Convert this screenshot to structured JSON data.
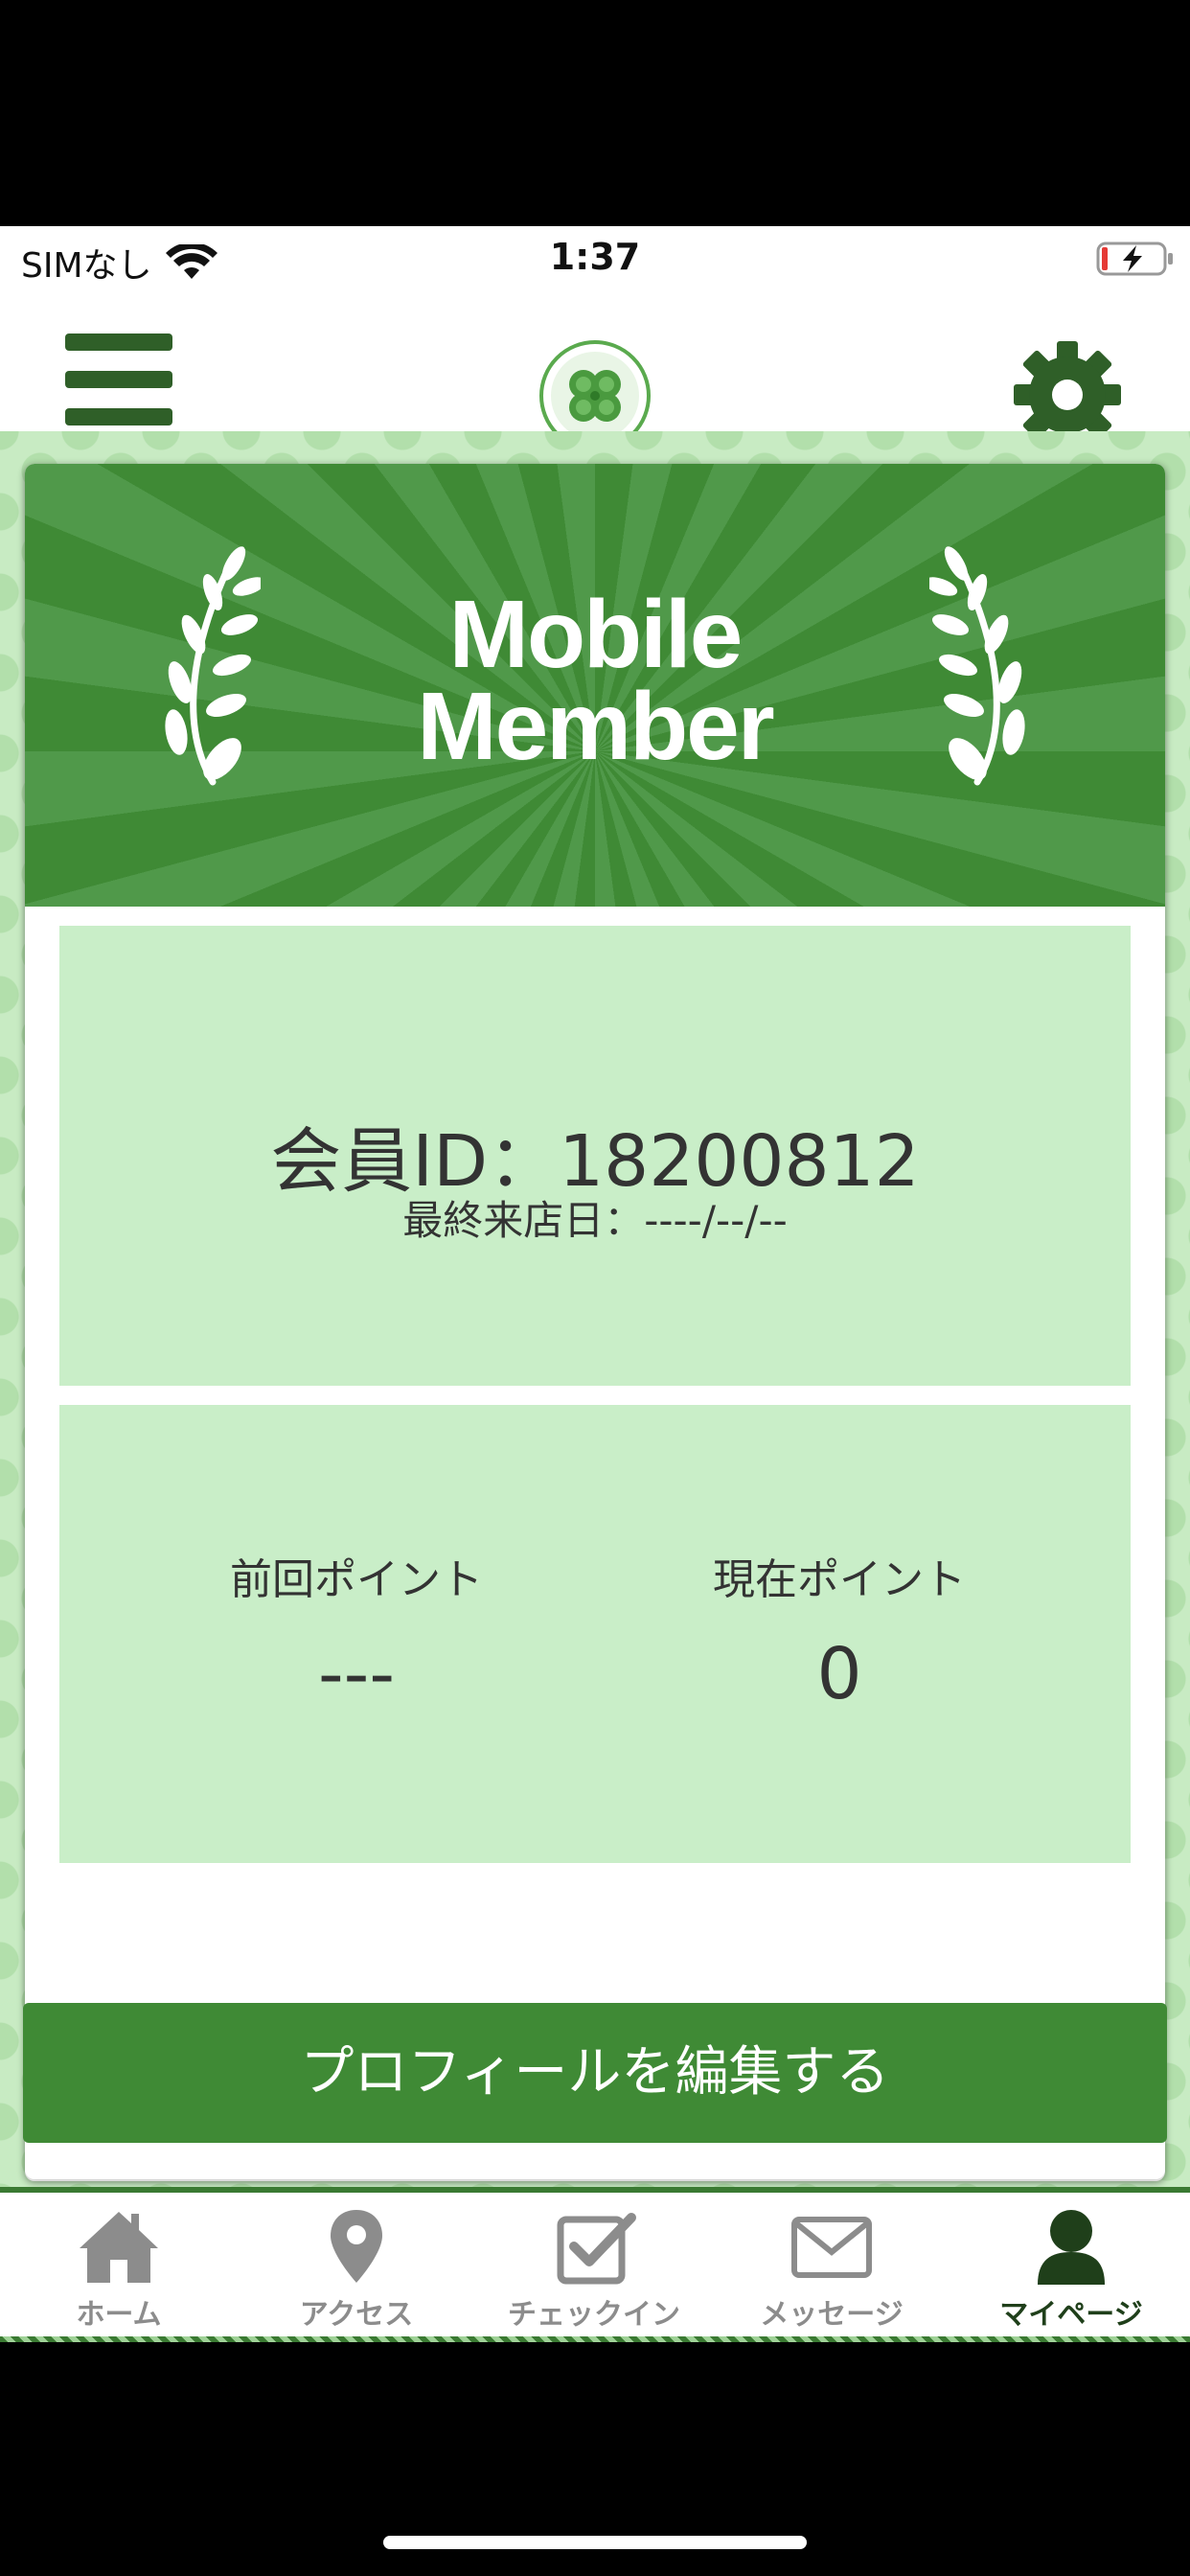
{
  "status_bar": {
    "carrier": "SIMなし",
    "time": "1:37"
  },
  "nav": {
    "menu_icon": "hamburger-menu-icon",
    "logo_icon": "clover-logo-icon",
    "settings_icon": "gear-icon"
  },
  "card": {
    "title_line1": "Mobile",
    "title_line2": "Member",
    "member_id": "会員ID：18200812",
    "last_visit": "最終来店日：----/--/--",
    "previous_points_label": "前回ポイント",
    "previous_points_value": "---",
    "current_points_label": "現在ポイント",
    "current_points_value": "0"
  },
  "edit_button_label": "プロフィールを編集する",
  "tabs": [
    {
      "label": "ホーム",
      "icon": "home-icon",
      "active": false
    },
    {
      "label": "アクセス",
      "icon": "map-pin-icon",
      "active": false
    },
    {
      "label": "チェックイン",
      "icon": "checkbox-icon",
      "active": false
    },
    {
      "label": "メッセージ",
      "icon": "envelope-icon",
      "active": false
    },
    {
      "label": "マイページ",
      "icon": "person-icon",
      "active": true
    }
  ],
  "colors": {
    "primary_green": "#3f8a35",
    "dark_green": "#2f5f28",
    "panel_green": "#c9eec8",
    "inactive_tab": "#8c8c8c"
  }
}
